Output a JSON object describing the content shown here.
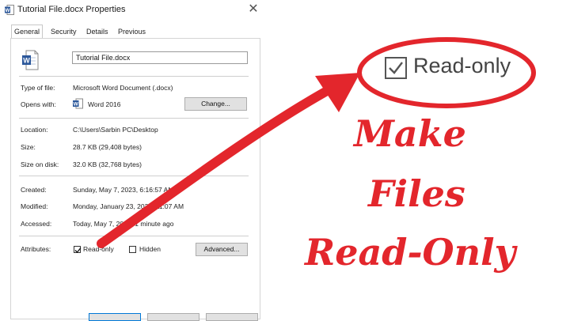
{
  "window": {
    "title": "Tutorial File.docx Properties"
  },
  "tabs": [
    {
      "label": "General",
      "active": true
    },
    {
      "label": "Security",
      "active": false
    },
    {
      "label": "Details",
      "active": false
    },
    {
      "label": "Previous Versions",
      "active": false
    }
  ],
  "file": {
    "name_value": "Tutorial File.docx",
    "icon": "word-document-icon"
  },
  "labels": {
    "type": "Type of file:",
    "opens": "Opens with:",
    "location": "Location:",
    "size": "Size:",
    "size_on_disk": "Size on disk:",
    "created": "Created:",
    "modified": "Modified:",
    "accessed": "Accessed:",
    "attributes": "Attributes:"
  },
  "values": {
    "type": "Microsoft Word Document (.docx)",
    "opens": "Word 2016",
    "location": "C:\\Users\\Sarbin PC\\Desktop",
    "size": "28.7 KB (29,408 bytes)",
    "size_on_disk": "32.0 KB (32,768 bytes)",
    "created": "Sunday, May 7, 2023, 6:16:57 AM",
    "modified": "Monday, January 23, 2023, 11:07 AM",
    "accessed": "Today, May 7, 2023, 1 minute ago"
  },
  "buttons": {
    "change": "Change...",
    "advanced": "Advanced..."
  },
  "attributes": {
    "readonly_label": "Read-only",
    "readonly_checked": true,
    "hidden_label": "Hidden",
    "hidden_checked": false
  },
  "callout": {
    "readonly_label": "Read-only"
  },
  "headline": {
    "line1": "Make",
    "line2": "Files",
    "line3": "Read-Only"
  },
  "colors": {
    "accent_red": "#e3262c",
    "word_blue": "#2b579a"
  }
}
